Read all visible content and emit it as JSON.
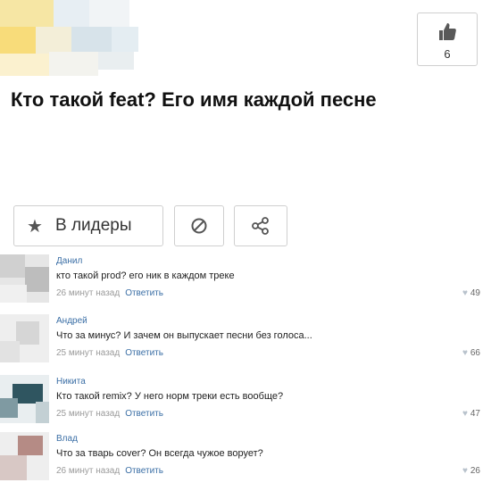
{
  "post": {
    "like_count": "6",
    "title": "Кто такой feat? Его имя каждой песне"
  },
  "actions": {
    "leader_label": "В лидеры"
  },
  "comments": [
    {
      "author": "Данил",
      "text": "кто такой prod? его ник в каждом треке",
      "time": "26 минут назад",
      "reply": "Ответить",
      "likes": "49"
    },
    {
      "author": "Андрей",
      "text": "Что за минус? И зачем он выпускает песни без голоса...",
      "time": "25 минут назад",
      "reply": "Ответить",
      "likes": "66"
    },
    {
      "author": "Никита",
      "text": "Кто такой remix? У него норм треки есть вообще?",
      "time": "25 минут назад",
      "reply": "Ответить",
      "likes": "47"
    },
    {
      "author": "Влад",
      "text": "Что за тварь cover? Он всегда чужое ворует?",
      "time": "26 минут назад",
      "reply": "Ответить",
      "likes": "26"
    }
  ],
  "icons": {
    "like": "thumbs-up-icon",
    "star": "star-icon",
    "block": "block-icon",
    "share": "share-icon",
    "heart": "heart-icon"
  },
  "colors": {
    "link": "#3a6ea5",
    "meta": "#9a9a9a"
  }
}
